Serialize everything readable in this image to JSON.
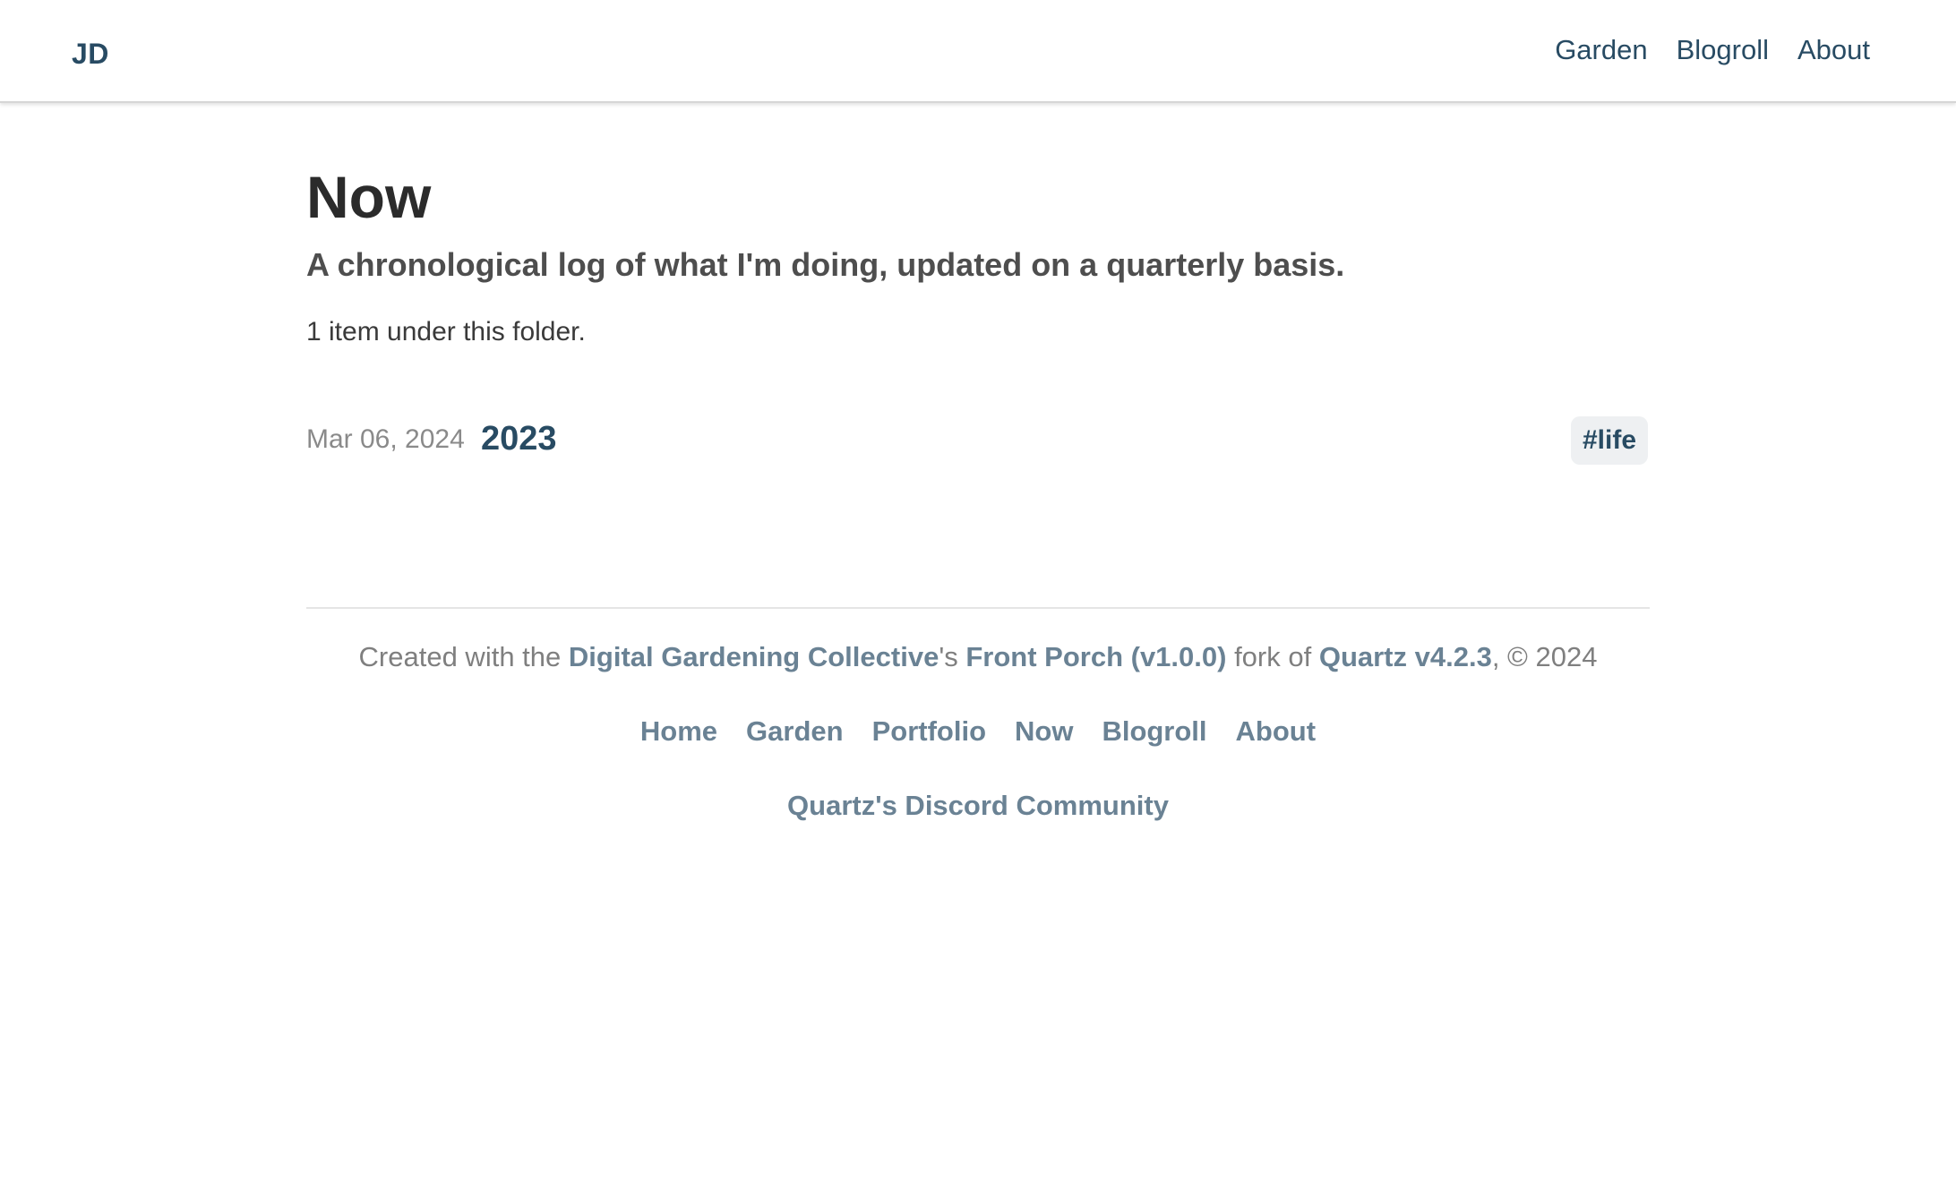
{
  "header": {
    "logo": "JD",
    "nav": [
      {
        "label": "Garden"
      },
      {
        "label": "Blogroll"
      },
      {
        "label": "About"
      }
    ]
  },
  "article": {
    "title": "Now",
    "subtitle": "A chronological log of what I'm doing, updated on a quarterly basis.",
    "folder_count": "1 item under this folder.",
    "items": [
      {
        "date": "Mar 06, 2024",
        "title": "2023",
        "tags": [
          "#life"
        ]
      }
    ]
  },
  "footer": {
    "credit": {
      "prefix": "Created with the ",
      "link1": "Digital Gardening Collective",
      "between1": "'s ",
      "link2": "Front Porch (v1.0.0)",
      "between2": " fork of ",
      "link3": "Quartz v4.2.3",
      "suffix": ", © 2024"
    },
    "links": [
      {
        "label": "Home"
      },
      {
        "label": "Garden"
      },
      {
        "label": "Portfolio"
      },
      {
        "label": "Now"
      },
      {
        "label": "Blogroll"
      },
      {
        "label": "About"
      }
    ],
    "extra_link": "Quartz's Discord Community"
  },
  "colors": {
    "accent": "#284b63",
    "footer_link": "#6a8294",
    "muted": "#8a8a8a",
    "tag_bg": "#eef0f2"
  }
}
